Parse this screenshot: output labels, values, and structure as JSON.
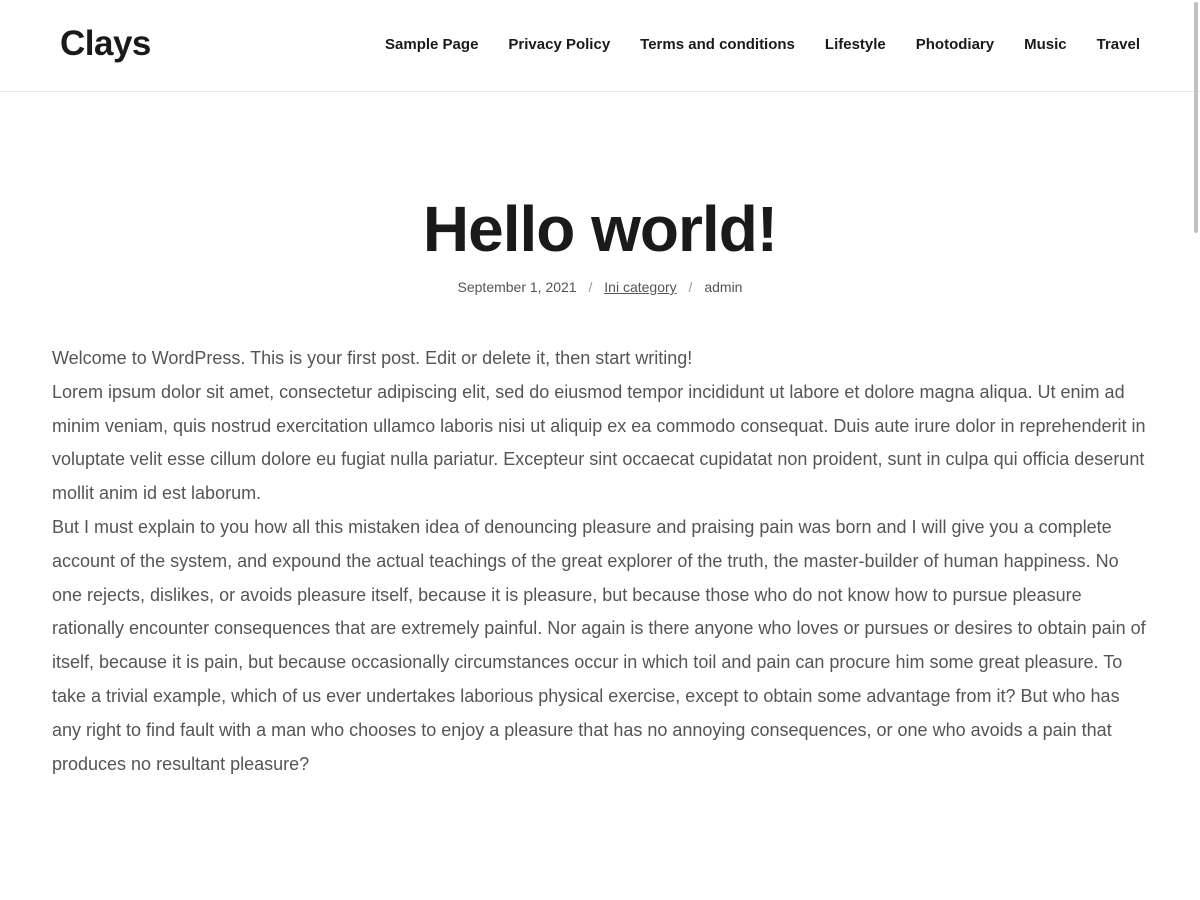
{
  "site": {
    "title": "Clays"
  },
  "nav": [
    "Sample Page",
    "Privacy Policy",
    "Terms and conditions",
    "Lifestyle",
    "Photodiary",
    "Music",
    "Travel"
  ],
  "post": {
    "title": "Hello world!",
    "date": "September 1, 2021",
    "category": "Ini category",
    "author": "admin",
    "separator": "/",
    "paragraphs": [
      "Welcome to WordPress. This is your first post. Edit or delete it, then start writing!",
      "Lorem ipsum dolor sit amet, consectetur adipiscing elit, sed do eiusmod tempor incididunt ut labore et dolore magna aliqua. Ut enim ad minim veniam, quis nostrud exercitation ullamco laboris nisi ut aliquip ex ea commodo consequat. Duis aute irure dolor in reprehenderit in voluptate velit esse cillum dolore eu fugiat nulla pariatur. Excepteur sint occaecat cupidatat non proident, sunt in culpa qui officia deserunt mollit anim id est laborum.",
      "But I must explain to you how all this mistaken idea of denouncing pleasure and praising pain was born and I will give you a complete account of the system, and expound the actual teachings of the great explorer of the truth, the master-builder of human happiness. No one rejects, dislikes, or avoids pleasure itself, because it is pleasure, but because those who do not know how to pursue pleasure rationally encounter consequences that are extremely painful. Nor again is there anyone who loves or pursues or desires to obtain pain of itself, because it is pain, but because occasionally circumstances occur in which toil and pain can procure him some great pleasure. To take a trivial example, which of us ever undertakes laborious physical exercise, except to obtain some advantage from it? But who has any right to find fault with a man who chooses to enjoy a pleasure that has no annoying consequences, or one who avoids a pain that produces no resultant pleasure?"
    ]
  }
}
